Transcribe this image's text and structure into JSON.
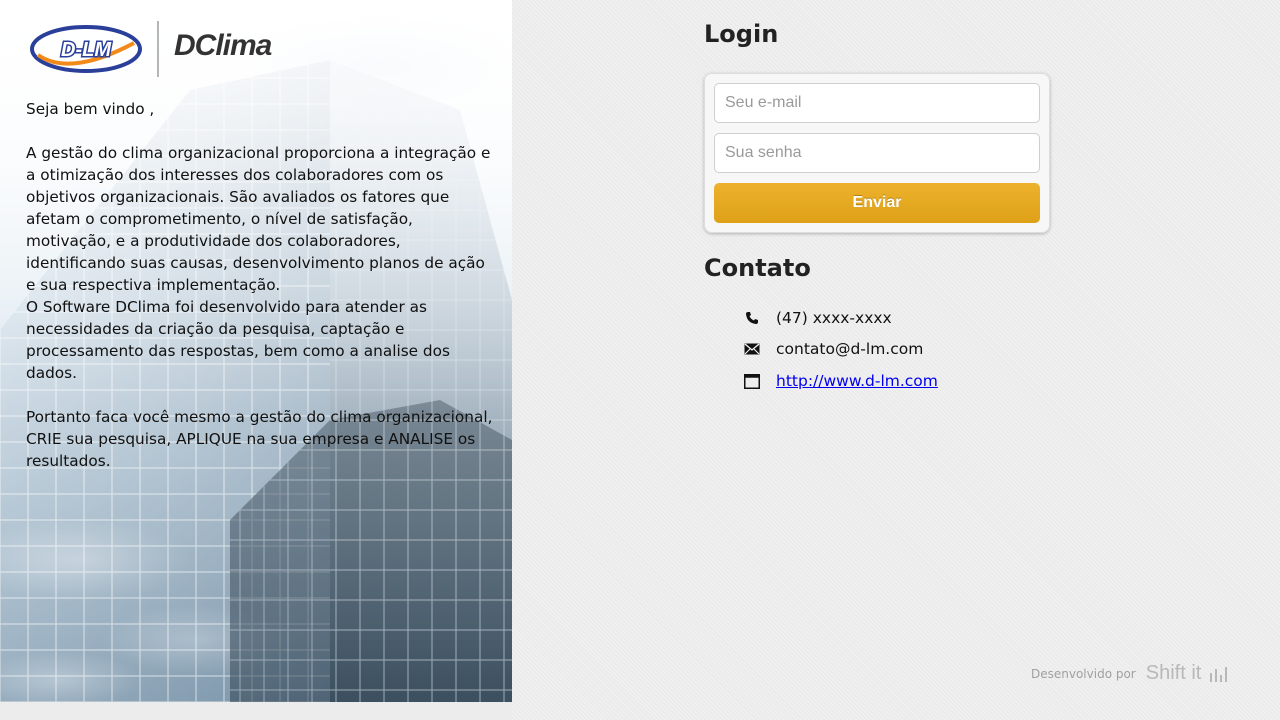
{
  "brand": {
    "dlm_logo_text": "D-LM",
    "product_name": "DClima"
  },
  "intro": {
    "greeting": "Seja bem vindo ,",
    "paragraph1": "A gestão do clima organizacional proporciona a integração e a otimização dos interesses dos colaboradores com os objetivos organizacionais. São avaliados os fatores que afetam o comprometimento, o nível de satisfação, motivação, e a produtividade dos colaboradores, identificando suas causas, desenvolvimento planos de ação e sua respectiva implementação.",
    "paragraph2": "O Software DClima foi desenvolvido para atender as necessidades da criação da pesquisa, captação e processamento das respostas, bem como a analise dos dados.",
    "paragraph3": "Portanto faca você mesmo a gestão do clima organizacional, CRIE sua pesquisa, APLIQUE na sua empresa e ANALISE os resultados."
  },
  "login": {
    "title": "Login",
    "email_placeholder": "Seu e-mail",
    "email_value": "",
    "password_placeholder": "Sua senha",
    "password_value": "",
    "submit_label": "Enviar"
  },
  "contact": {
    "title": "Contato",
    "phone": "(47) xxxx-xxxx",
    "email": "contato@d-lm.com",
    "website": "http://www.d-lm.com"
  },
  "footer": {
    "developed_by": "Desenvolvido por",
    "developer_brand": "Shift it"
  },
  "icons": {
    "phone": "phone-icon",
    "mail": "envelope-icon",
    "web": "browser-window-icon",
    "developer_mark": "bars-icon"
  },
  "colors": {
    "submit_button": "#e6a820",
    "link": "#0000ee",
    "dlm_blue": "#2a3f9a",
    "dlm_orange": "#f28a1a"
  }
}
